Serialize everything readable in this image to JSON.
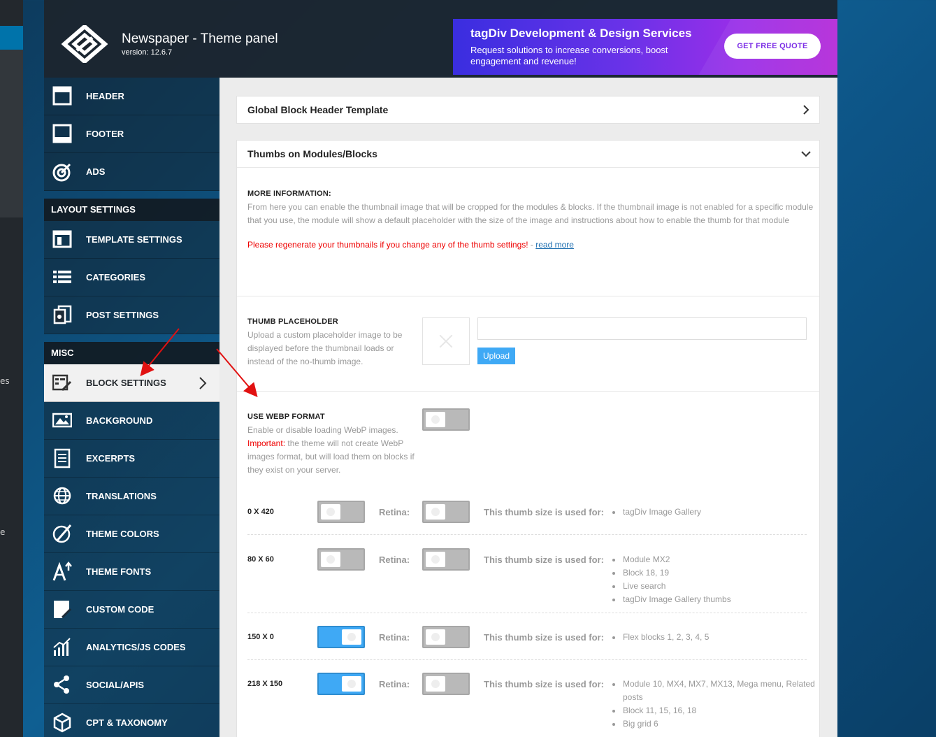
{
  "header": {
    "title": "Newspaper - Theme panel",
    "version": "version: 12.6.7"
  },
  "ad": {
    "title": "tagDiv Development & Design Services",
    "text": "Request solutions to increase conversions, boost engagement and revenue!",
    "button": "GET FREE QUOTE"
  },
  "wp_fragments": [
    "es",
    "e"
  ],
  "sidebar": {
    "items_top": [
      {
        "label": "HEADER",
        "icon": "header-icon"
      },
      {
        "label": "FOOTER",
        "icon": "footer-icon"
      },
      {
        "label": "ADS",
        "icon": "target-icon"
      }
    ],
    "section_layout": "LAYOUT SETTINGS",
    "items_layout": [
      {
        "label": "TEMPLATE SETTINGS",
        "icon": "template-icon"
      },
      {
        "label": "CATEGORIES",
        "icon": "list-icon"
      },
      {
        "label": "POST SETTINGS",
        "icon": "post-settings-icon"
      }
    ],
    "section_misc": "MISC",
    "items_misc": [
      {
        "label": "BLOCK SETTINGS",
        "icon": "block-settings-icon",
        "active": true
      },
      {
        "label": "BACKGROUND",
        "icon": "image-icon"
      },
      {
        "label": "EXCERPTS",
        "icon": "document-icon"
      },
      {
        "label": "TRANSLATIONS",
        "icon": "globe-icon"
      },
      {
        "label": "THEME COLORS",
        "icon": "palette-icon"
      },
      {
        "label": "THEME FONTS",
        "icon": "font-icon"
      },
      {
        "label": "CUSTOM CODE",
        "icon": "code-icon"
      },
      {
        "label": "ANALYTICS/JS CODES",
        "icon": "analytics-icon"
      },
      {
        "label": "SOCIAL/APIS",
        "icon": "share-icon"
      },
      {
        "label": "CPT & TAXONOMY",
        "icon": "cube-icon"
      }
    ]
  },
  "content": {
    "acc1_title": "Global Block Header Template",
    "acc2_title": "Thumbs on Modules/Blocks",
    "more_info_label": "MORE INFORMATION:",
    "more_info_text": "From here you can enable the thumbnail image that will be cropped for the modules & blocks. If the thumbnail image is not enabled for a specific module that you use, the module will show a default placeholder with the size of the image and instructions about how to enable the thumb for that module",
    "warning_text": "Please regenerate your thumbnails if you change any of the thumb settings!",
    "warning_sep": " - ",
    "read_more": "read more",
    "placeholder_label": "THUMB PLACEHOLDER",
    "placeholder_desc": "Upload a custom placeholder image to be displayed before the thumbnail loads or instead of the no-thumb image.",
    "placeholder_input": "",
    "upload_button": "Upload",
    "webp_label": "USE WEBP FORMAT",
    "webp_desc1": "Enable or disable loading WebP images.",
    "webp_important": "Important:",
    "webp_desc2": " the theme will not create WebP images format, but will load them on blocks if they exist on your server.",
    "webp_enabled": false,
    "retina_label": "Retina:",
    "used_label": "This thumb size is used for:",
    "thumb_rows": [
      {
        "size": "0 X 420",
        "enabled": false,
        "retina": false,
        "uses": [
          "tagDiv Image Gallery"
        ]
      },
      {
        "size": "80 X 60",
        "enabled": false,
        "retina": false,
        "uses": [
          "Module MX2",
          "Block 18, 19",
          "Live search",
          "tagDiv Image Gallery thumbs"
        ]
      },
      {
        "size": "150 X 0",
        "enabled": true,
        "retina": false,
        "uses": [
          "Flex blocks 1, 2, 3, 4, 5"
        ]
      },
      {
        "size": "218 X 150",
        "enabled": true,
        "retina": false,
        "uses": [
          "Module 10, MX4, MX7, MX13, Mega menu, Related posts",
          "Block 11, 15, 16, 18",
          "Big grid 6"
        ]
      }
    ]
  },
  "colors": {
    "accent_blue": "#3fa9f5",
    "warning_red": "#e00000",
    "arrow_red": "#e11111"
  }
}
